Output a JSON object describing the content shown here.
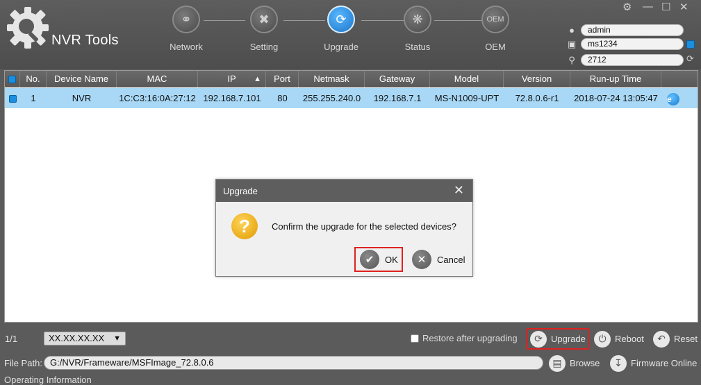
{
  "app": {
    "title": "NVR Tools"
  },
  "nav": [
    {
      "label": "Network",
      "icon": "globe-icon",
      "active": false
    },
    {
      "label": "Setting",
      "icon": "tools-icon",
      "active": false
    },
    {
      "label": "Upgrade",
      "icon": "upgrade-icon",
      "active": true
    },
    {
      "label": "Status",
      "icon": "status-icon",
      "active": false
    },
    {
      "label": "OEM",
      "icon": "oem-icon",
      "active": false
    }
  ],
  "credentials": {
    "username": "admin",
    "password": "ms1234",
    "port": "2712"
  },
  "table": {
    "headers": [
      "No.",
      "Device Name",
      "MAC",
      "IP",
      "Port",
      "Netmask",
      "Gateway",
      "Model",
      "Version",
      "Run-up Time"
    ],
    "sort_column": "IP",
    "rows": [
      {
        "no": "1",
        "device_name": "NVR",
        "mac": "1C:C3:16:0A:27:12",
        "ip": "192.168.7.101",
        "port": "80",
        "netmask": "255.255.240.0",
        "gateway": "192.168.7.1",
        "model": "MS-N1009-UPT",
        "version": "72.8.0.6-r1",
        "run_up_time": "2018-07-24 13:05:47"
      }
    ]
  },
  "dialog": {
    "title": "Upgrade",
    "message": "Confirm the upgrade for the selected devices?",
    "ok_label": "OK",
    "cancel_label": "Cancel"
  },
  "bottom": {
    "pager": "1/1",
    "version_select": "XX.XX.XX.XX",
    "restore_label": "Restore after upgrading",
    "upgrade_label": "Upgrade",
    "reboot_label": "Reboot",
    "reset_label": "Reset",
    "file_path_label": "File Path:",
    "file_path": "G:/NVR/Frameware/MSFImage_72.8.0.6",
    "browse_label": "Browse",
    "firmware_label": "Firmware Online",
    "operating_info_label": "Operating Information"
  },
  "colors": {
    "accent": "#1e74c8",
    "selected_row": "#a8d8f6",
    "highlight_border": "#e02020"
  }
}
